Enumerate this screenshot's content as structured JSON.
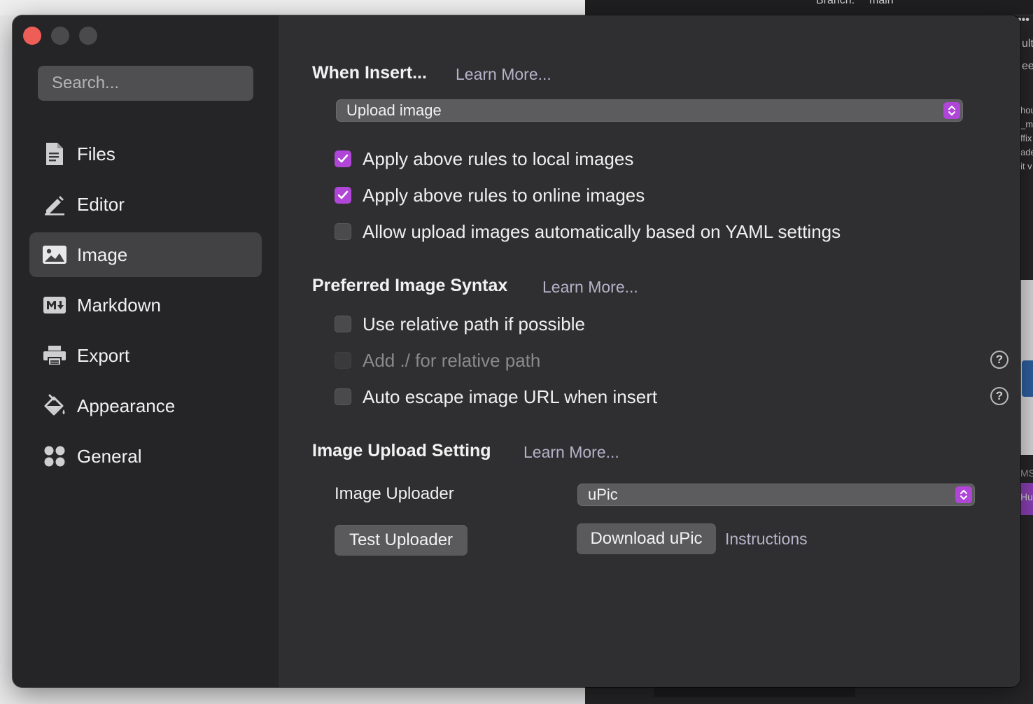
{
  "window": {
    "traffic_lights": [
      "close",
      "minimize",
      "zoom"
    ]
  },
  "sidebar": {
    "search_placeholder": "Search...",
    "items": [
      {
        "label": "Files",
        "icon": "file-icon"
      },
      {
        "label": "Editor",
        "icon": "pencil-icon"
      },
      {
        "label": "Image",
        "icon": "image-icon",
        "active": true
      },
      {
        "label": "Markdown",
        "icon": "markdown-icon"
      },
      {
        "label": "Export",
        "icon": "printer-icon"
      },
      {
        "label": "Appearance",
        "icon": "paint-bucket-icon"
      },
      {
        "label": "General",
        "icon": "grid-icon"
      }
    ]
  },
  "when_insert": {
    "title": "When Insert...",
    "learn_more": "Learn More...",
    "action_select": "Upload image",
    "options": [
      {
        "label": "Apply above rules to local images",
        "checked": true,
        "disabled": false
      },
      {
        "label": "Apply above rules to online images",
        "checked": true,
        "disabled": false
      },
      {
        "label": "Allow upload images automatically based on YAML settings",
        "checked": false,
        "disabled": false
      }
    ]
  },
  "syntax": {
    "title": "Preferred Image Syntax",
    "learn_more": "Learn More...",
    "options": [
      {
        "label": "Use relative path if possible",
        "checked": false,
        "disabled": false
      },
      {
        "label": "Add ./ for relative path",
        "checked": false,
        "disabled": true,
        "help": "?"
      },
      {
        "label": "Auto escape image URL when insert",
        "checked": false,
        "disabled": false,
        "help": "?"
      }
    ]
  },
  "upload": {
    "title": "Image Upload Setting",
    "learn_more": "Learn More...",
    "uploader_label": "Image Uploader",
    "uploader_value": "uPic",
    "test_button": "Test Uploader",
    "download_button": "Download uPic",
    "instructions_link": "Instructions"
  },
  "background_window": {
    "fragments": [
      "Branch:",
      "main",
      "•••",
      "ult",
      "ee",
      "hou",
      "_m",
      "ffix",
      "ade",
      "it v",
      "MS",
      "Hu"
    ]
  },
  "colors": {
    "accent": "#b046d8",
    "close": "#ee5e56",
    "link": "#b6b2c8"
  }
}
